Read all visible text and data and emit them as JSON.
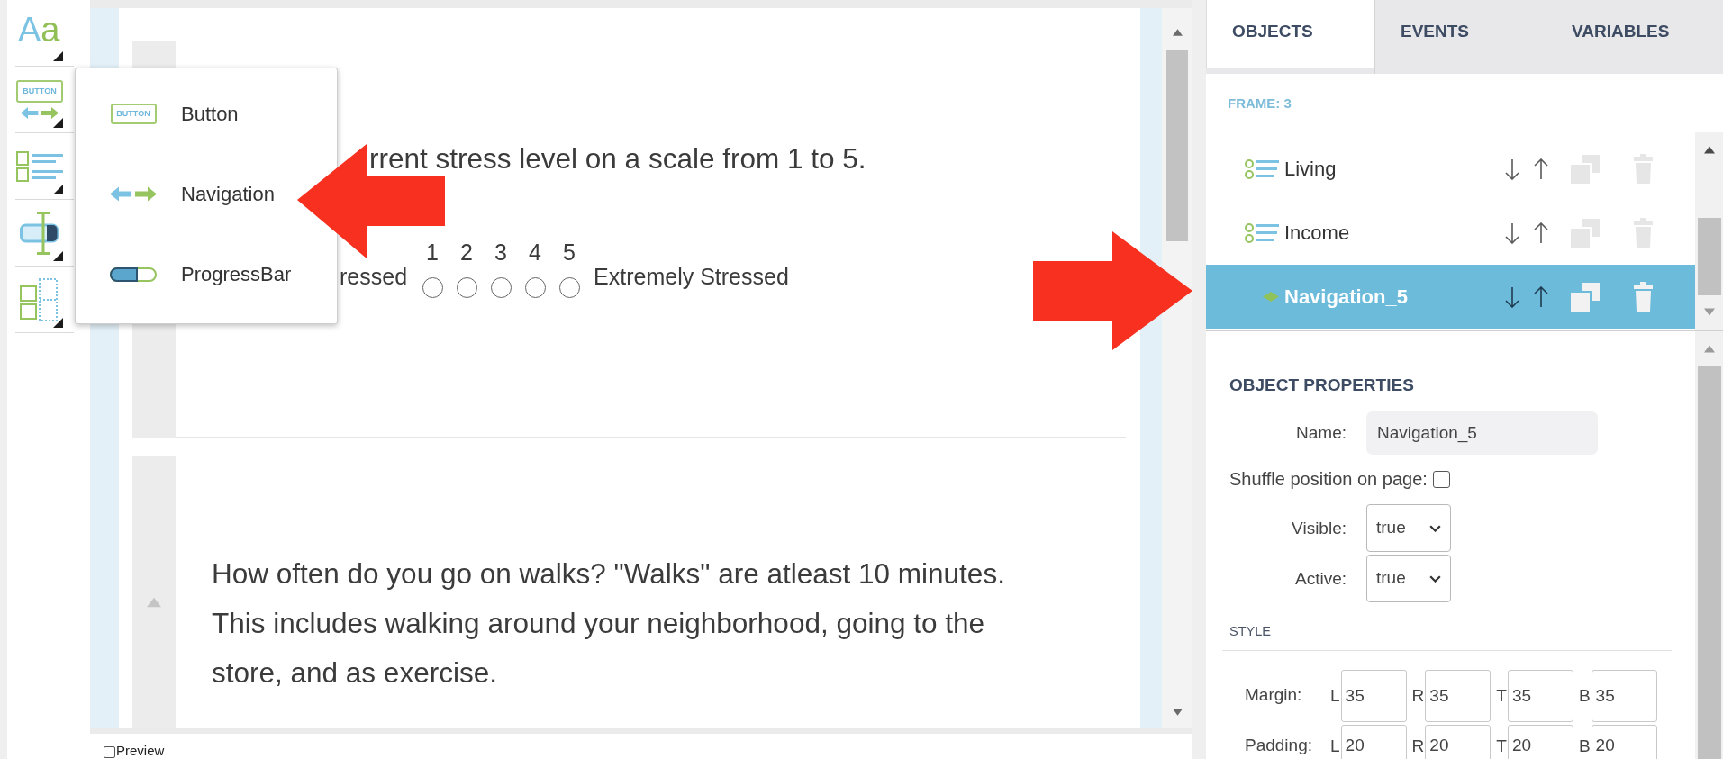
{
  "toolbar": {
    "tools": [
      {
        "kind": "text",
        "glyph": "Aa"
      },
      {
        "kind": "button",
        "glyph": "BUTTON"
      },
      {
        "kind": "list"
      },
      {
        "kind": "input"
      },
      {
        "kind": "layout"
      }
    ]
  },
  "tool_menu": {
    "items": [
      {
        "kind": "button",
        "glyph": "BUTTON",
        "label": "Button"
      },
      {
        "kind": "navigation",
        "label": "Navigation"
      },
      {
        "kind": "progress",
        "label": "ProgressBar"
      }
    ]
  },
  "canvas": {
    "questions": [
      {
        "text": "rrent stress level on a scale from 1 to 5.",
        "scale": {
          "low_label": "ressed",
          "high_label": "Extremely Stressed",
          "options": [
            {
              "label": "1",
              "selected": false
            },
            {
              "label": "2",
              "selected": false
            },
            {
              "label": "3",
              "selected": false
            },
            {
              "label": "4",
              "selected": false
            },
            {
              "label": "5",
              "selected": false
            }
          ]
        }
      },
      {
        "text": "How often do you go on walks? \"Walks\" are atleast 10 minutes. This includes walking around your neighborhood, going to the store, and as exercise.",
        "show_move_arrow": true
      }
    ]
  },
  "preview": {
    "label": "Preview",
    "checked": false
  },
  "panel": {
    "tabs": [
      {
        "label": "OBJECTS",
        "selected": true
      },
      {
        "label": "EVENTS",
        "selected": false
      },
      {
        "label": "VARIABLES",
        "selected": false
      }
    ],
    "frame_label": "FRAME: 3",
    "objects": [
      {
        "kind": "list",
        "name": "Living",
        "selected": false
      },
      {
        "kind": "list",
        "name": "Income",
        "selected": false
      },
      {
        "kind": "navigation",
        "name": "Navigation_5",
        "selected": true
      }
    ],
    "properties": {
      "heading": "OBJECT PROPERTIES",
      "name": {
        "label": "Name:",
        "value": "Navigation_5"
      },
      "shuffle": {
        "label": "Shuffle position on page:",
        "checked": false
      },
      "selects": [
        {
          "label": "Visible:",
          "value": "true"
        },
        {
          "label": "Active:",
          "value": "true"
        }
      ],
      "style": {
        "heading": "STYLE",
        "rows": [
          {
            "label": "Margin:",
            "fields": [
              {
                "side": "L",
                "value": "35"
              },
              {
                "side": "R",
                "value": "35"
              },
              {
                "side": "T",
                "value": "35"
              },
              {
                "side": "B",
                "value": "35"
              }
            ]
          },
          {
            "label": "Padding:",
            "fields": [
              {
                "side": "L",
                "value": "20"
              },
              {
                "side": "R",
                "value": "20"
              },
              {
                "side": "T",
                "value": "20"
              },
              {
                "side": "B",
                "value": "20"
              }
            ]
          }
        ]
      }
    }
  }
}
